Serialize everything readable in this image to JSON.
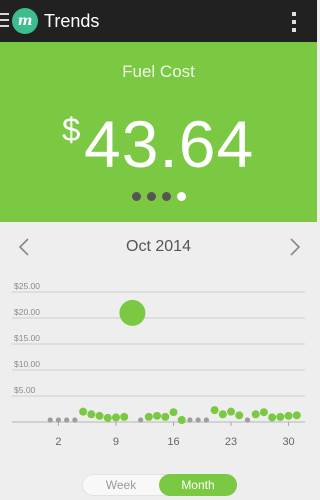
{
  "app": {
    "title": "Trends",
    "logo_text": "m"
  },
  "metric": {
    "label": "Fuel Cost",
    "currency": "$",
    "value": "43.64",
    "pages": 4,
    "active_page": 4
  },
  "period": {
    "label": "Oct 2014"
  },
  "toggle": {
    "week_label": "Week",
    "month_label": "Month",
    "selected": "Month"
  },
  "colors": {
    "accent": "#7bc843",
    "appbar": "#212121",
    "logo": "#3dbd8e",
    "no_data_dot": "#9e9e9e"
  },
  "icons": {
    "menu": "menu-icon",
    "overflow": "more-vert-icon",
    "prev": "chevron-left-icon",
    "next": "chevron-right-icon"
  },
  "chart_data": {
    "type": "scatter",
    "title": "",
    "xlabel": "",
    "ylabel": "",
    "x_ticks": [
      "2",
      "9",
      "16",
      "23",
      "30"
    ],
    "y_ticks": [
      "$5.00",
      "$10.00",
      "$15.00",
      "$20.00",
      "$25.00"
    ],
    "xlim": [
      0,
      32
    ],
    "ylim": [
      0,
      25
    ],
    "grid": true,
    "x": [
      1,
      2,
      3,
      4,
      5,
      6,
      7,
      8,
      9,
      10,
      11,
      12,
      13,
      14,
      15,
      16,
      17,
      18,
      19,
      20,
      21,
      22,
      23,
      24,
      25,
      26,
      27,
      28,
      29,
      30,
      31
    ],
    "values": [
      0,
      0,
      0,
      0,
      1.6,
      1.1,
      0.8,
      0.4,
      0.5,
      0.6,
      20.6,
      0,
      0.6,
      0.8,
      0.6,
      1.5,
      0,
      0,
      0,
      0.5,
      1.9,
      1.1,
      1.6,
      0.9,
      0,
      1.1,
      1.5,
      0.5,
      0.6,
      0.8,
      0.9
    ],
    "zero_points": [
      1,
      2,
      3,
      4,
      12,
      18,
      19,
      20,
      25
    ]
  }
}
